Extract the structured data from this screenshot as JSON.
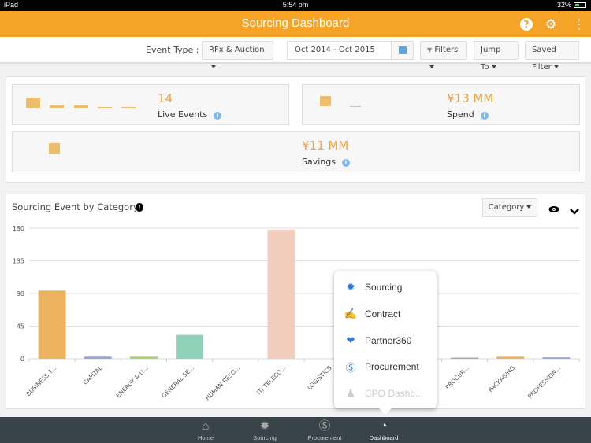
{
  "statusbar": {
    "device": "iPad",
    "time": "5:54 pm",
    "battery": "32%"
  },
  "appbar": {
    "title": "Sourcing Dashboard",
    "help_icon": "?",
    "settings_icon": "⚙",
    "more_icon": "⋮"
  },
  "filters": {
    "event_type_label": "Event Type :",
    "event_type_value": "RFx & Auction",
    "date_range": "Oct 2014 - Oct 2015",
    "filters_label": "Filters",
    "jump_to_label": "Jump To",
    "saved_filter_label": "Saved Filter"
  },
  "kpis": {
    "live_events": {
      "value": "14",
      "label": "Live Events"
    },
    "spend": {
      "value": "¥13 MM",
      "label": "Spend"
    },
    "savings": {
      "value": "¥11 MM",
      "label": "Savings"
    }
  },
  "chart_panel": {
    "title": "Sourcing Event by Category",
    "category_button": "Category",
    "eye_icon": "👁",
    "collapse_icon": "⌄"
  },
  "chart_data": {
    "type": "bar",
    "title": "Sourcing Event by Category",
    "xlabel": "",
    "ylabel": "",
    "ylim": [
      0,
      180
    ],
    "yticks": [
      0,
      45,
      90,
      135,
      180
    ],
    "grid": true,
    "categories": [
      "BUSINESS T...",
      "CAPITAL",
      "ENERGY & U...",
      "GENERAL SE...",
      "HUMAN RESO...",
      "IT/ TELECO...",
      "LOGISTICS",
      "",
      "",
      "PROCUR...",
      "PACKAGING",
      "PROFESSION..."
    ],
    "values": [
      94,
      3,
      3,
      33,
      0,
      178,
      0,
      0,
      0,
      1,
      3,
      2
    ],
    "colors": [
      "#ecb25e",
      "#8fa9dc",
      "#a9d46f",
      "#8fd1b8",
      "#cccccc",
      "#f0cdbc",
      "#cccccc",
      "#cccccc",
      "#cccccc",
      "#a0aab0",
      "#ecb25e",
      "#8fa9dc"
    ]
  },
  "popup_menu": {
    "items": [
      {
        "label": "Sourcing",
        "icon": "✹",
        "enabled": true
      },
      {
        "label": "Contract",
        "icon": "✍",
        "enabled": true
      },
      {
        "label": "Partner360",
        "icon": "❤",
        "enabled": true
      },
      {
        "label": "Procurement",
        "icon": "Ⓢ",
        "enabled": true
      },
      {
        "label": "CPO Dashb...",
        "icon": "♟",
        "enabled": false
      }
    ]
  },
  "tabbar": {
    "tabs": [
      {
        "label": "Home",
        "icon": "⌂"
      },
      {
        "label": "Sourcing",
        "icon": "✹"
      },
      {
        "label": "Procurement",
        "icon": "Ⓢ"
      },
      {
        "label": "Dashboard",
        "icon": "◔"
      }
    ]
  }
}
